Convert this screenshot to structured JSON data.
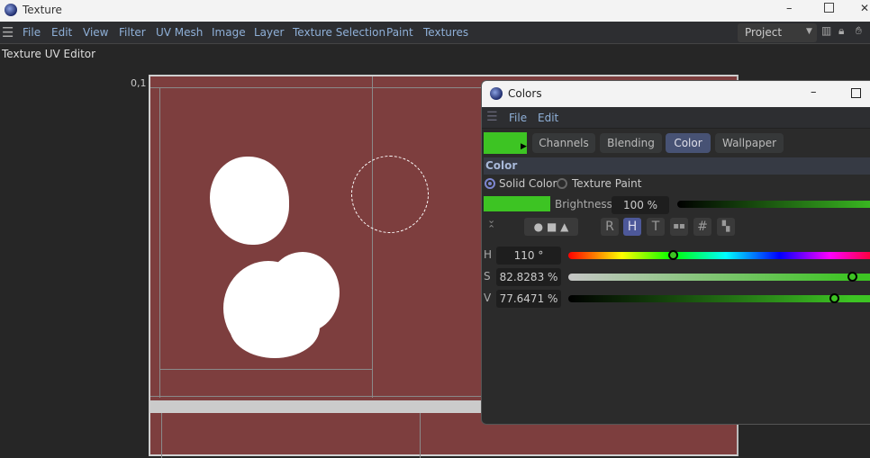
{
  "window": {
    "title": "Texture"
  },
  "menu": [
    "File",
    "Edit",
    "View",
    "Filter",
    "UV Mesh",
    "Image",
    "Layer",
    "Texture Selection",
    "Paint",
    "Textures"
  ],
  "layout_select": "Project",
  "panel_title": "Texture UV Editor",
  "canvas": {
    "coord_label": "0,1",
    "texture_color": "#7d3e3e"
  },
  "colors": {
    "title": "Colors",
    "menu": [
      "File",
      "Edit"
    ],
    "current_color": "#3dc423",
    "tabs": [
      "Channels",
      "Blending",
      "Color",
      "Wallpaper"
    ],
    "active_tab": "Color",
    "section": "Color",
    "mode_options": [
      "Solid Color",
      "Texture Paint"
    ],
    "selected_mode": "Solid Color",
    "brightness_label": "Brightness",
    "brightness_value": "100 %",
    "mode_buttons": [
      "R",
      "H",
      "T",
      "#"
    ],
    "active_mode_button": "H",
    "hsv": [
      {
        "label": "H",
        "value": "110 °",
        "fraction": 0.305
      },
      {
        "label": "S",
        "value": "82.8283 %",
        "fraction": 0.828
      },
      {
        "label": "V",
        "value": "77.6471 %",
        "fraction": 0.776
      }
    ]
  }
}
